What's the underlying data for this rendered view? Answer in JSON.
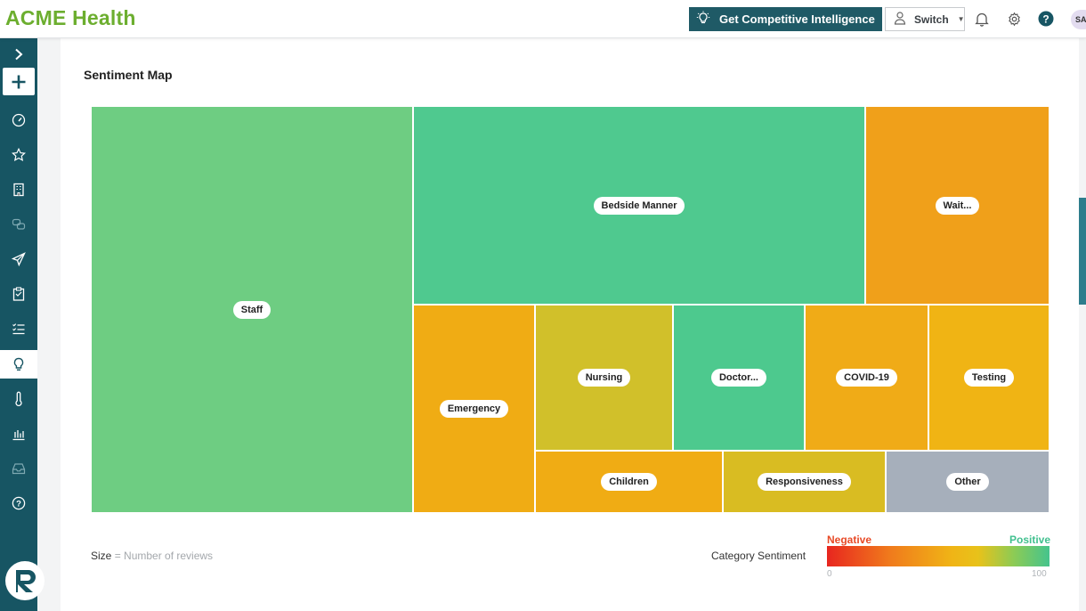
{
  "header": {
    "brand": "ACME Health",
    "ci_button_label": "Get Competitive Intelligence",
    "switch_label": "Switch",
    "avatar_initials": "SA"
  },
  "page": {
    "title": "Sentiment Map"
  },
  "treemap": {
    "tiles": [
      {
        "label": "Staff",
        "color": "#6ecd82"
      },
      {
        "label": "Bedside Manner",
        "color": "#4fc98f"
      },
      {
        "label": "Wait...",
        "color": "#f0a01a"
      },
      {
        "label": "Emergency",
        "color": "#f0ac14"
      },
      {
        "label": "Nursing",
        "color": "#d1c02a"
      },
      {
        "label": "Doctor...",
        "color": "#4dc98e"
      },
      {
        "label": "COVID-19",
        "color": "#f0ab17"
      },
      {
        "label": "Testing",
        "color": "#f0b414"
      },
      {
        "label": "Children",
        "color": "#f0ac14"
      },
      {
        "label": "Responsiveness",
        "color": "#d9bc22"
      },
      {
        "label": "Other",
        "color": "#a6afbb"
      }
    ]
  },
  "legend": {
    "size_key": "Size",
    "size_desc": "= Number of reviews",
    "sentiment_label": "Category Sentiment",
    "negative": "Negative",
    "positive": "Positive",
    "min": "0",
    "max": "100"
  },
  "colors": {
    "brand": "#6cae2f",
    "sidebar": "#175563",
    "ci_button": "#1f5a66"
  }
}
